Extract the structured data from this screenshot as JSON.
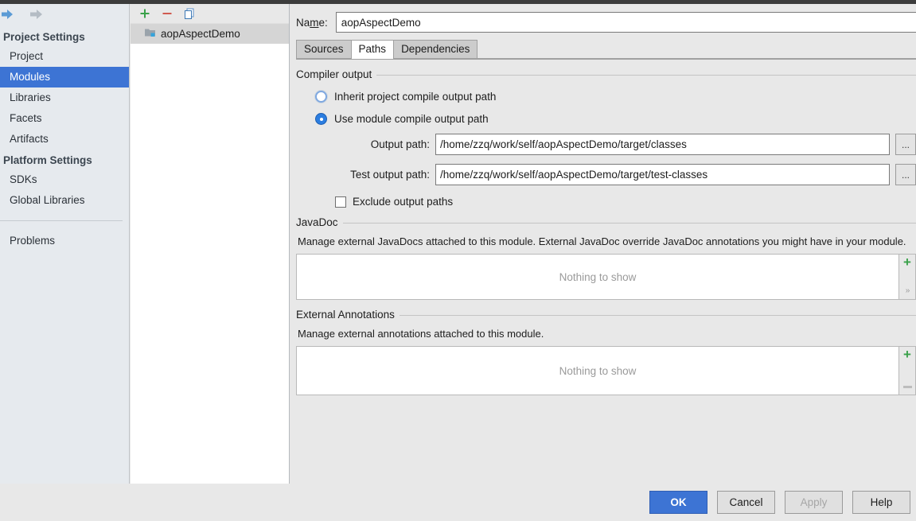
{
  "window": {
    "nav_back_icon": "arrow-left-icon",
    "nav_forward_icon": "arrow-right-icon"
  },
  "sidebar": {
    "groups": [
      {
        "title": "Project Settings",
        "items": [
          {
            "label": "Project",
            "selected": false
          },
          {
            "label": "Modules",
            "selected": true
          },
          {
            "label": "Libraries",
            "selected": false
          },
          {
            "label": "Facets",
            "selected": false
          },
          {
            "label": "Artifacts",
            "selected": false
          }
        ]
      },
      {
        "title": "Platform Settings",
        "items": [
          {
            "label": "SDKs",
            "selected": false
          },
          {
            "label": "Global Libraries",
            "selected": false
          }
        ]
      }
    ],
    "problems_label": "Problems"
  },
  "modules_panel": {
    "toolbar": {
      "add_icon": "plus-icon",
      "remove_icon": "minus-icon",
      "copy_icon": "copy-icon"
    },
    "items": [
      {
        "label": "aopAspectDemo",
        "icon": "module-folder-icon",
        "selected": true
      }
    ]
  },
  "main": {
    "name_label_before": "Na",
    "name_label_mnemonic": "m",
    "name_label_after": "e:",
    "name_value": "aopAspectDemo",
    "tabs": [
      {
        "label": "Sources",
        "active": false
      },
      {
        "label": "Paths",
        "active": true
      },
      {
        "label": "Dependencies",
        "active": false
      }
    ],
    "compiler_output": {
      "title": "Compiler output",
      "radio_inherit_label": "Inherit project compile output path",
      "radio_inherit_selected": false,
      "radio_module_label": "Use module compile output path",
      "radio_module_selected": true,
      "output_path_label": "Output path:",
      "output_path_value": "/home/zzq/work/self/aopAspectDemo/target/classes",
      "test_output_path_label": "Test output path:",
      "test_output_path_value": "/home/zzq/work/self/aopAspectDemo/target/test-classes",
      "browse_label": "...",
      "exclude_label": "Exclude output paths",
      "exclude_checked": false
    },
    "javadoc": {
      "title": "JavaDoc",
      "description": "Manage external JavaDocs attached to this module. External JavaDoc override JavaDoc annotations you might have in your module.",
      "empty_text": "Nothing to show",
      "add_icon": "plus-icon",
      "expand_icon": "chevron-double-right-icon"
    },
    "external_annotations": {
      "title": "External Annotations",
      "description": "Manage external annotations attached to this module.",
      "empty_text": "Nothing to show",
      "add_icon": "plus-icon",
      "remove_icon": "minus-icon"
    }
  },
  "buttons": {
    "ok": "OK",
    "cancel": "Cancel",
    "apply": "Apply",
    "help": "Help"
  },
  "colors": {
    "accent_blue": "#3d74d4",
    "add_green": "#3aa14a",
    "remove_red": "#d05a50",
    "panel_bg": "#e8e8e8",
    "sidebar_bg": "#e6eaee"
  }
}
